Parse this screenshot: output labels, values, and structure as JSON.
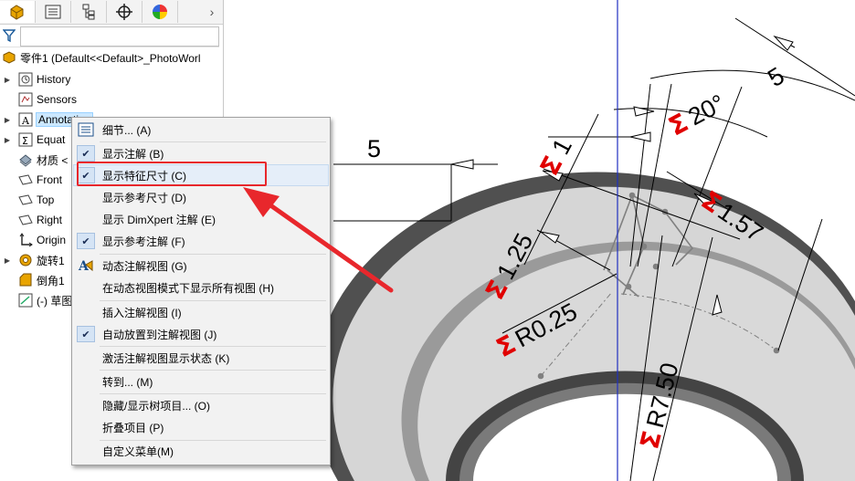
{
  "tabs": [
    {
      "name": "feature-manager-tab",
      "icon": "feature-manager-icon"
    },
    {
      "name": "property-manager-tab",
      "icon": "property-list-icon"
    },
    {
      "name": "configuration-manager-tab",
      "icon": "configuration-tree-icon"
    },
    {
      "name": "dimxpert-manager-tab",
      "icon": "crosshair-icon"
    },
    {
      "name": "display-manager-tab",
      "icon": "color-wheel-icon"
    }
  ],
  "tab_more_glyph": "›",
  "tree": {
    "root_label": "零件1  (Default<<Default>_PhotoWorl",
    "items": [
      {
        "label": "History",
        "icon": "history-icon",
        "expandable": true
      },
      {
        "label": "Sensors",
        "icon": "sensors-icon",
        "expandable": false
      },
      {
        "label": "Annotation",
        "icon": "annotation-icon",
        "expandable": true
      },
      {
        "label": "Equat",
        "icon": "equations-icon",
        "expandable": true
      },
      {
        "label": "材质 <",
        "icon": "material-icon",
        "expandable": false
      },
      {
        "label": "Front",
        "icon": "plane-icon",
        "expandable": false
      },
      {
        "label": "Top",
        "icon": "plane-icon",
        "expandable": false
      },
      {
        "label": "Right",
        "icon": "plane-icon",
        "expandable": false
      },
      {
        "label": "Origin",
        "icon": "origin-icon",
        "expandable": false
      },
      {
        "label": "旋转1",
        "icon": "revolve-icon",
        "expandable": true
      },
      {
        "label": "倒角1",
        "icon": "chamfer-icon",
        "expandable": false
      },
      {
        "label": "(-) 草图",
        "icon": "sketch-icon",
        "expandable": false
      }
    ]
  },
  "context_menu": {
    "items": [
      {
        "label": "细节... (A)",
        "checked": false,
        "icon": "details-list-icon"
      },
      {
        "label": "显示注解 (B)",
        "checked": true
      },
      {
        "label": "显示特征尺寸 (C)",
        "checked": true,
        "highlighted": true
      },
      {
        "label": "显示参考尺寸 (D)",
        "checked": false
      },
      {
        "label": "显示 DimXpert 注解 (E)",
        "checked": false
      },
      {
        "label": "显示参考注解 (F)",
        "checked": true
      },
      {
        "label": "动态注解视图 (G)",
        "checked": false,
        "icon": "dynamic-annotation-icon"
      },
      {
        "label": "在动态视图模式下显示所有视图 (H)",
        "checked": false
      },
      {
        "label": "插入注解视图 (I)",
        "checked": false
      },
      {
        "label": "自动放置到注解视图 (J)",
        "checked": true
      },
      {
        "label": "激活注解视图显示状态 (K)",
        "checked": false
      },
      {
        "label": "转到... (M)",
        "checked": false
      },
      {
        "label": "隐藏/显示树项目... (O)",
        "checked": false
      },
      {
        "label": "折叠项目 (P)",
        "checked": false
      },
      {
        "label": "自定义菜单(M)",
        "checked": false
      }
    ]
  },
  "dimensions": {
    "top_linear": "5",
    "top_right": "5",
    "angle": "20°",
    "d1": "1",
    "d157": "1.57",
    "d125": "1.25",
    "r025": "R0.25",
    "r750": "R7.50",
    "sigma_glyph": "Σ"
  },
  "colors": {
    "highlight_red": "#e8272c",
    "sigma_red": "#e00000",
    "origin_axis_blue": "#2030c0",
    "part_light_gray": "#d4d4d4",
    "part_dark_gray": "#5a5a5a"
  }
}
